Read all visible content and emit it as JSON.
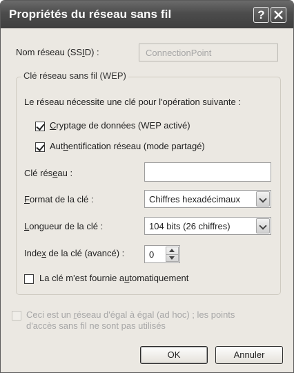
{
  "window": {
    "title": "Propriétés du réseau sans fil",
    "help_glyph": "?"
  },
  "ssid": {
    "label_pre": "Nom réseau (SS",
    "label_u": "I",
    "label_post": "D) :",
    "value": "ConnectionPoint"
  },
  "wep_group": {
    "title": "Clé réseau sans fil (WEP)",
    "intro": "Le réseau nécessite une clé pour l'opération suivante :",
    "encrypt": {
      "u": "C",
      "rest": "ryptage de données (WEP activé)",
      "checked": true
    },
    "auth": {
      "pre": "Aut",
      "u": "h",
      "post": "entification réseau (mode partagé)",
      "checked": true
    },
    "key_label": {
      "pre": "Clé rés",
      "u": "e",
      "post": "au :"
    },
    "key_value": "",
    "format_label": {
      "u": "F",
      "post": "ormat de la clé :"
    },
    "format_value": "Chiffres hexadécimaux",
    "length_label": {
      "u": "L",
      "post": "ongueur de la clé :"
    },
    "length_value": "104 bits (26 chiffres)",
    "index_label": {
      "pre": "Inde",
      "u": "x",
      "post": " de la clé (avancé) :"
    },
    "index_value": "0",
    "auto_key": {
      "pre": "La clé m'est fournie a",
      "u": "u",
      "post": "tomatiquement",
      "checked": false
    }
  },
  "adhoc": {
    "line1_pre": "Ceci est un ",
    "line1_u": "r",
    "line1_post": "éseau d'égal à égal (ad hoc) ; les points",
    "line2": "d'accès sans fil ne sont pas utilisés",
    "checked": false
  },
  "buttons": {
    "ok": "OK",
    "cancel": "Annuler"
  }
}
